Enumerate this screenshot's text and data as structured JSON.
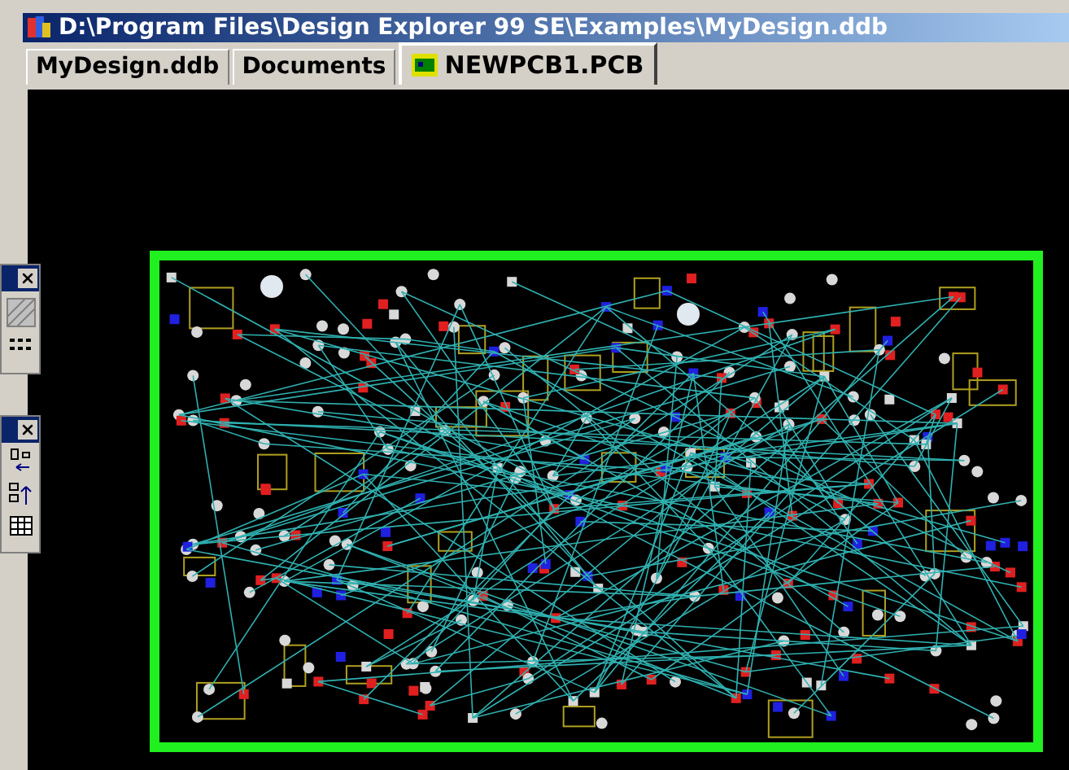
{
  "window": {
    "title": "D:\\Program Files\\Design Explorer 99 SE\\Examples\\MyDesign.ddb"
  },
  "tabs": [
    {
      "label": "MyDesign.ddb",
      "selected": false
    },
    {
      "label": "Documents",
      "selected": false
    },
    {
      "label": "NEWPCB1.PCB",
      "selected": true
    }
  ]
}
